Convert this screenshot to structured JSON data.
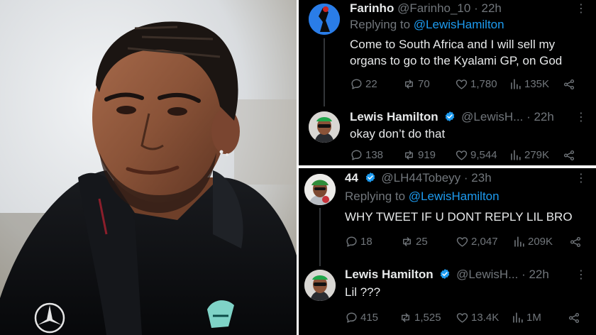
{
  "colors": {
    "background": "#000000",
    "text": "#e7e9ea",
    "muted": "#71767b",
    "link": "#1d9bf0",
    "verified": "#1d9bf0"
  },
  "photo": {
    "subject": "man with braided hair in black team jacket",
    "jacket_logos": [
      "mercedes-star-icon",
      "petronas-logo-icon"
    ]
  },
  "tweets": [
    {
      "name": "Farinho",
      "handle": "@Farinho_10",
      "dot": "·",
      "time": "22h",
      "reply_prefix": "Replying to",
      "reply_mention": "@LewisHamilton",
      "text": "Come to South Africa and I will sell my organs to go to the Kyalami GP, on God",
      "replies": "22",
      "reposts": "70",
      "likes": "1,780",
      "views": "135K"
    },
    {
      "name": "Lewis Hamilton",
      "handle": "@LewisH...",
      "dot": "·",
      "time": "22h",
      "text": "okay don’t do that",
      "replies": "138",
      "reposts": "919",
      "likes": "9,544",
      "views": "279K"
    },
    {
      "name": "44",
      "handle": "@LH44Tobeyy",
      "dot": "·",
      "time": "23h",
      "reply_prefix": "Replying to",
      "reply_mention": "@LewisHamilton",
      "text": "WHY TWEET IF U DONT REPLY LIL BRO",
      "replies": "18",
      "reposts": "25",
      "likes": "2,047",
      "views": "209K"
    },
    {
      "name": "Lewis Hamilton",
      "handle": "@LewisH...",
      "dot": "·",
      "time": "22h",
      "text": "Lil ???",
      "replies": "415",
      "reposts": "1,525",
      "likes": "13.4K",
      "views": "1M"
    }
  ],
  "more_glyph": "⋮"
}
